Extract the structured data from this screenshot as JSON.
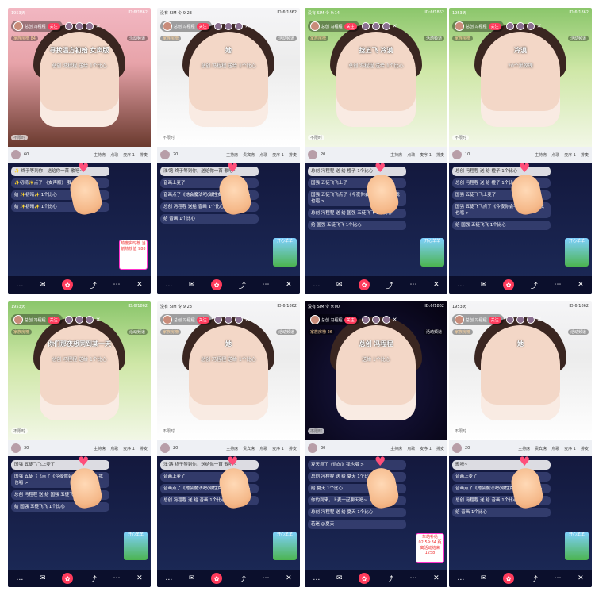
{
  "panels": [
    {
      "status": {
        "left": "1953天",
        "right": "ID:6f1862"
      },
      "host": {
        "name": "总创 冯程程",
        "follow": "关注"
      },
      "family": "家族房榜 84",
      "activity": "活动频道",
      "overlay1": "寻找温方初始 女声版",
      "overlay2": "总创 冯程程 送给 1个比心",
      "muted": "不限时",
      "seats": [
        "60",
        "主持席",
        "点歌",
        "麦序 1",
        "排麦"
      ],
      "chat": [
        {
          "text": "✨ 终于等到你，送给你一首 歌吧~"
        },
        {
          "text": "✨初晴✨点了 《女声版》 我也唱 >"
        },
        {
          "text": "给 ✨初晴✨ 1个比心"
        },
        {
          "text": "给 ✨初晴✨ 1个比心"
        }
      ],
      "promo": "热度实时榜 当前热榜值 988"
    },
    {
      "status": {
        "left": "没有 SIM 令 9:23",
        "right": "ID:6f1862"
      },
      "host": {
        "name": "总创 冯程程",
        "follow": "关注"
      },
      "family": "家族房榜",
      "activity": "活动频道",
      "overlay1": "她",
      "overlay2": "总创 冯程程 送给 1个比心",
      "muted": "不限时",
      "seats": [
        "20",
        "主持席",
        "贵宾席",
        "点歌",
        "麦序 1",
        "排麦"
      ],
      "chat": [
        {
          "text": "浅'路 终于等到你，送给你一首 歌吧~"
        },
        {
          "text": "音画上麦了"
        },
        {
          "text": "音画点了《她会魔法吧(磁性女版)》我也唱 >"
        },
        {
          "text": "总创 冯程程 送给 音画 1个比心"
        },
        {
          "text": "给 音画 1个比心"
        }
      ],
      "promo": "开心羊羊"
    },
    {
      "status": {
        "left": "没有 SIM 令 9:14",
        "right": "ID:6f1862"
      },
      "host": {
        "name": "总创 冯程程",
        "follow": "关注"
      },
      "family": "家族房榜",
      "activity": "活动频道",
      "overlay1": "捻五飞 冷漠",
      "overlay2": "总创 冯程程 送给 1个比心",
      "muted": "不限时",
      "seats": [
        "20",
        "主持席",
        "点歌",
        "麦序 1",
        "排麦"
      ],
      "chat": [
        {
          "text": "总创 冯程程 送 给 橙子 1个比心"
        },
        {
          "text": "国强 五徒飞飞上了"
        },
        {
          "text": "国强 五徒飞飞点了《今夜你会不会想起我》我也唱 >"
        },
        {
          "text": "总创 冯程程 送 给 国强 五徒飞飞 1个比心"
        },
        {
          "text": "给 国强 五徒飞飞 1个比心"
        }
      ],
      "promo": "开心羊羊"
    },
    {
      "status": {
        "left": "1953天",
        "right": "ID:6f1862"
      },
      "host": {
        "name": "总创 冯程程",
        "follow": "关注"
      },
      "family": "家族房榜",
      "activity": "活动频道",
      "overlay1": "冷漠",
      "overlay2": "20个黑玫瑰",
      "muted": "不限时",
      "seats": [
        "10",
        "主持席",
        "点歌",
        "麦序 1",
        "排麦"
      ],
      "chat": [
        {
          "text": "总创 冯程程 送 给 橙子 1个比心"
        },
        {
          "text": "总创 冯程程 送 给 橙子 1个比心"
        },
        {
          "text": "国强 五徒飞飞上麦了"
        },
        {
          "text": "国强 五徒飞飞点了《今夜你会不会想起我》我也唱 >"
        },
        {
          "text": "给 国强 五徒飞飞 1个比心"
        }
      ],
      "promo": "开心羊羊"
    },
    {
      "status": {
        "left": "1953天",
        "right": "ID:6f1862"
      },
      "host": {
        "name": "总创 冯程程",
        "follow": "关注"
      },
      "family": "家族房榜",
      "activity": "活动频道",
      "overlay1": "你们那夜想同到某一天",
      "overlay2": "总创 冯程程 送给 1个比心",
      "muted": "不限时",
      "seats": [
        "30",
        "主持席",
        "点歌",
        "麦序 1",
        "排麦"
      ],
      "chat": [
        {
          "text": "国强 五徒飞飞上麦了"
        },
        {
          "text": "国强 五徒飞飞点了《今夜你会不会想起我》我也唱 >"
        },
        {
          "text": "总创 冯程程 送 给 国强 五徒飞飞 1个比心"
        },
        {
          "text": "给 国强 五徒飞飞 1个比心"
        }
      ],
      "promo": "开心羊羊"
    },
    {
      "status": {
        "left": "没有 SIM 令 9:23",
        "right": "ID:6f1862"
      },
      "host": {
        "name": "总创 冯程程",
        "follow": "关注"
      },
      "family": "家族房榜",
      "activity": "活动频道",
      "overlay1": "她",
      "overlay2": "总创 冯程程 送给 1个比心",
      "muted": "不限时",
      "seats": [
        "20",
        "主持席",
        "贵宾席",
        "点歌",
        "麦序 1",
        "排麦"
      ],
      "chat": [
        {
          "text": "浅'路 终于等到你，送给你一首 歌吧~"
        },
        {
          "text": "音画上麦了"
        },
        {
          "text": "音画点了《她会魔法吧(磁性女版)》我也唱 >"
        },
        {
          "text": "总创 冯程程 送 给 音画 1个比心"
        }
      ],
      "promo": "开心羊羊"
    },
    {
      "status": {
        "left": "没有 SIM 令 9:00",
        "right": "ID:6f1862"
      },
      "host": {
        "name": "总创 冯程程",
        "follow": "关注"
      },
      "family": "家族房榜 26",
      "activity": "活动频道",
      "overlay1": "总创 冯程程",
      "overlay2": "送给 1个比心",
      "muted": "不限时",
      "seats": [
        "30",
        "主持席",
        "点歌",
        "麦序 1",
        "排麦"
      ],
      "chat": [
        {
          "text": "夏天点了《你的》我也唱 >"
        },
        {
          "text": "总创 冯程程 送 给 夏天 1个比心"
        },
        {
          "text": "给 夏天 1个比心"
        },
        {
          "text": "你的到来，上麦一起聊天吧~"
        },
        {
          "text": "总创 冯程程 送 给 夏天 1个比心"
        },
        {
          "text": "若迷 @夏天"
        }
      ],
      "promo": "车站补给 02:59:34 距离活动结束 1258"
    },
    {
      "status": {
        "left": "1953天",
        "right": "ID:6f1862"
      },
      "host": {
        "name": "总创 冯程程",
        "follow": "关注"
      },
      "family": "家族房榜",
      "activity": "活动频道",
      "overlay1": "她",
      "overlay2": "",
      "muted": "不限时",
      "seats": [
        "20",
        "主持席",
        "贵宾席",
        "点歌",
        "麦序 1",
        "排麦"
      ],
      "chat": [
        {
          "text": "歌吧~"
        },
        {
          "text": "音画上麦了"
        },
        {
          "text": "音画点了《她会魔法吧(磁性女版)》我也唱 >"
        },
        {
          "text": "总创 冯程程 送 给 音画 1个比心"
        },
        {
          "text": "给 音画 1个比心"
        }
      ],
      "promo": "开心羊羊"
    }
  ],
  "icons": {
    "bottom": [
      "chat-bubble-icon",
      "mail-icon",
      "gift-icon",
      "share-icon",
      "more-icon",
      "close-icon"
    ]
  },
  "colors": {
    "accent": "#ff3b5c",
    "chat_bg": "#1c2a58"
  }
}
